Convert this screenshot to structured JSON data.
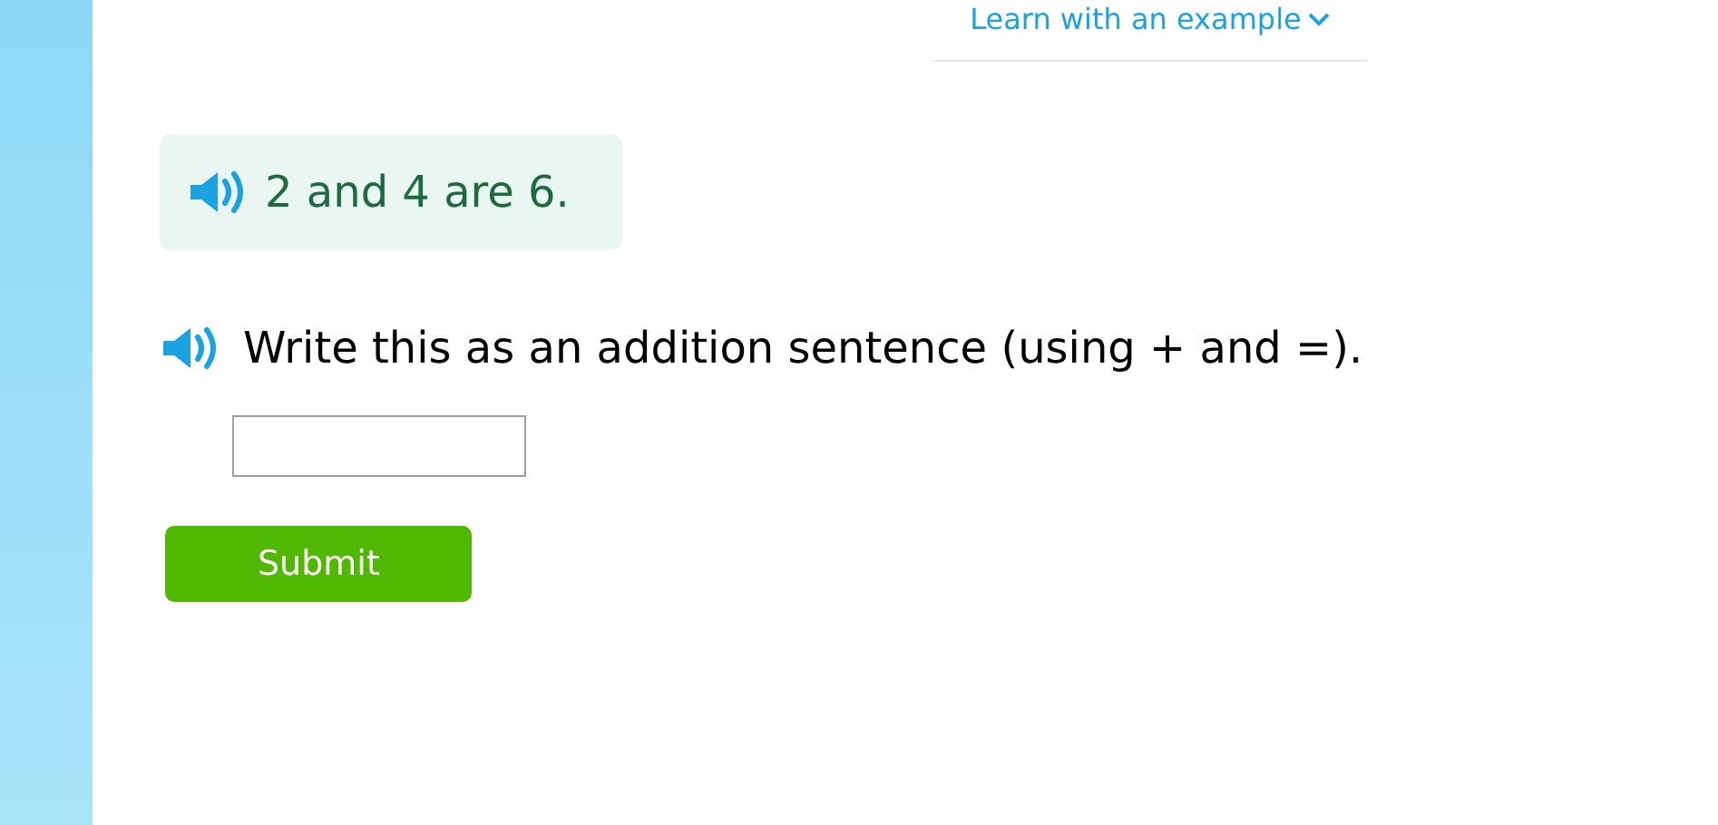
{
  "example_link": {
    "label": "Learn with an example"
  },
  "statement": {
    "text": "2 and 4 are 6."
  },
  "question": {
    "text": "Write this as an addition sentence (using + and =)."
  },
  "submit": {
    "label": "Submit"
  }
}
